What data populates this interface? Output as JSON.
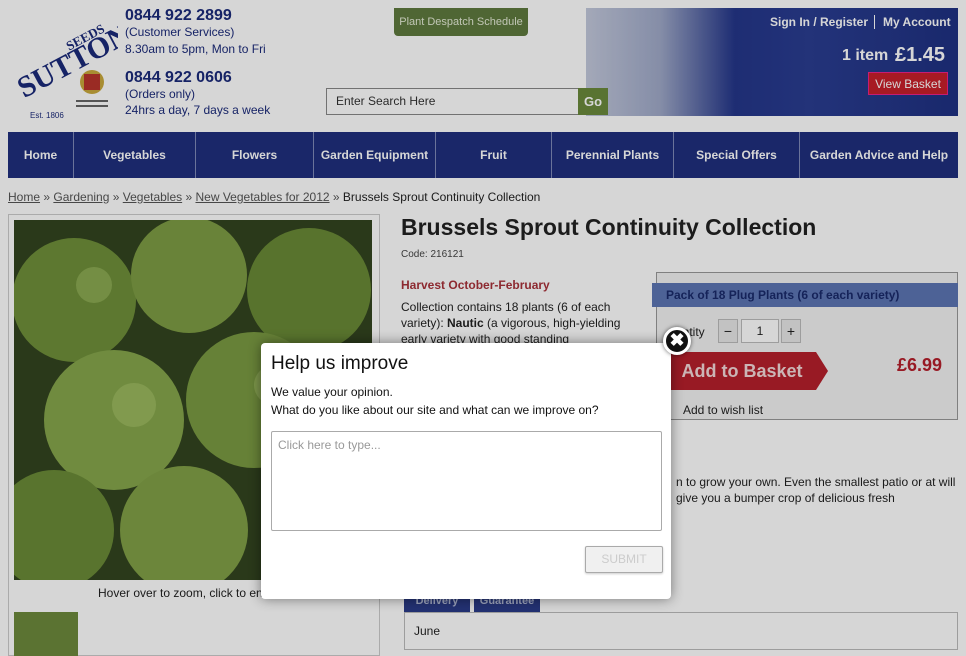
{
  "header": {
    "phone1": "0844 922 2899",
    "phone1_sub1": "(Customer Services)",
    "phone1_sub2": "8.30am to 5pm, Mon to Fri",
    "phone2": "0844 922 0606",
    "phone2_sub1": "(Orders only)",
    "phone2_sub2": "24hrs a day, 7 days a week",
    "logo_text": "SUTTONS SEEDS",
    "logo_est": "Est. 1806",
    "dispatch_label": "Plant Despatch Schedule",
    "search_placeholder": "Enter Search Here",
    "search_button": "Go",
    "signin": "Sign In / Register",
    "account": "My Account",
    "basket_count": "1 item",
    "basket_total": "£1.45",
    "view_basket": "View Basket"
  },
  "nav": [
    "Home",
    "Vegetables",
    "Flowers",
    "Garden Equipment",
    "Fruit",
    "Perennial Plants",
    "Special Offers",
    "Garden Advice and Help"
  ],
  "breadcrumb": {
    "items": [
      "Home",
      "Gardening",
      "Vegetables",
      "New Vegetables for 2012"
    ],
    "current": "Brussels Sprout Continuity Collection"
  },
  "product": {
    "title": "Brussels Sprout Continuity Collection",
    "code": "Code: 216121",
    "harvest": "Harvest October-February",
    "desc_a": "Collection contains 18 plants (6 of each variety): ",
    "desc_bold": "Nautic",
    "desc_b": " (a vigorous, high-yielding early variety with good standing",
    "desc2": "n to grow your own. Even the smallest patio or at will give you a bumper crop of delicious fresh",
    "image_hint": "Hover over to zoom, click to en",
    "pack": "Pack of 18 Plug Plants (6 of each variety)",
    "qty_label": "antity",
    "qty": "1",
    "add_basket": "Add to Basket",
    "price": "£6.99",
    "wishlist": "Add to wish list",
    "tabs": [
      "Delivery",
      "Guarantee"
    ],
    "delivery_month": "June"
  },
  "modal": {
    "title": "Help us improve",
    "line1": "We value your opinion.",
    "line2": "What do you like about our site and what can we improve on?",
    "placeholder": "Click here to type...",
    "submit": "SUBMIT",
    "close": "✖"
  },
  "colors": {
    "brand_navy": "#1f2f7e",
    "accent_red": "#b51f2b",
    "green": "#6b8a3c"
  }
}
